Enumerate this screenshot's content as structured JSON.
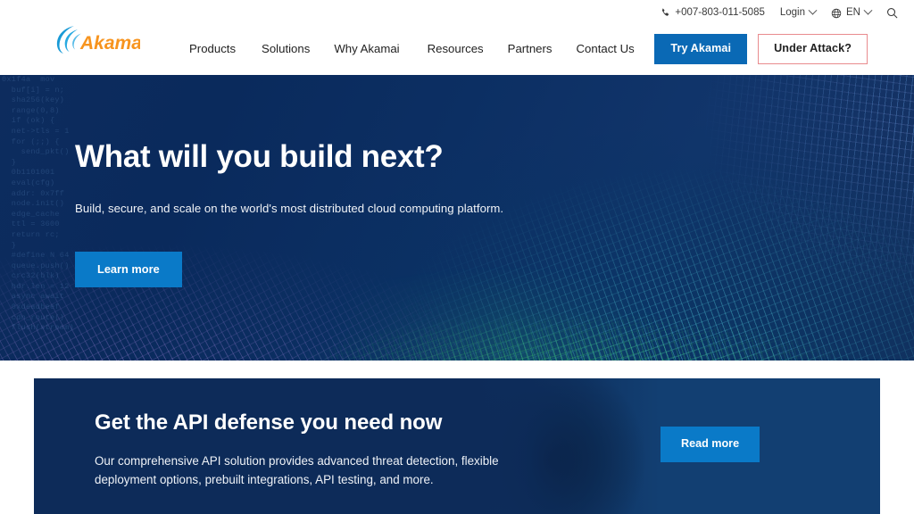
{
  "header": {
    "utility": {
      "phone_icon": "phone-icon",
      "phone": "+007-803-011-5085",
      "login": "Login",
      "globe_icon": "globe-icon",
      "language": "EN",
      "search_icon": "search-icon"
    },
    "logo": {
      "text": "Akamai",
      "swoosh_color": "#199ad6",
      "text_color": "#f7941e"
    },
    "nav": [
      {
        "label": "Products"
      },
      {
        "label": "Solutions"
      },
      {
        "label": "Why Akamai"
      },
      {
        "label": "Resources"
      },
      {
        "label": "Partners"
      },
      {
        "label": "Contact Us"
      }
    ],
    "cta": {
      "try_label": "Try Akamai",
      "try_bg": "#0a69b5",
      "attack_label": "Under Attack?",
      "attack_border": "#e98b8e"
    }
  },
  "hero": {
    "title": "What will you build next?",
    "subtitle": "Build, secure, and scale on the world's most distributed cloud computing platform.",
    "button_label": "Learn more",
    "button_bg": "#0a7ac8",
    "background_color": "#0c2f63",
    "code_text": "0x1f4a  mov\n  buf[i] = n;\n  sha256(key)\n  range(0,8)\n  if (ok) {\n  net->tls = 1\n  for (;;) {\n    send_pkt()\n  }\n  0b1101001\n  eval(cfg)\n  addr: 0x7ff\n  node.init()\n  edge_cache\n  ttl = 3600\n  return rc;\n  }\n  #define N 64\n  queue.push()\n  crc32(blk)\n  hdr.len = 12\n  async await\n  0xdeadbeef\n  cdn_route()\n  flush(stream)"
  },
  "api_banner": {
    "title": "Get the API defense you need now",
    "description": "Our comprehensive API solution provides advanced threat detection, flexible deployment options, prebuilt integrations, API testing, and more.",
    "button_label": "Read more",
    "button_bg": "#0a7ac8",
    "background_color": "#0d2b59"
  }
}
